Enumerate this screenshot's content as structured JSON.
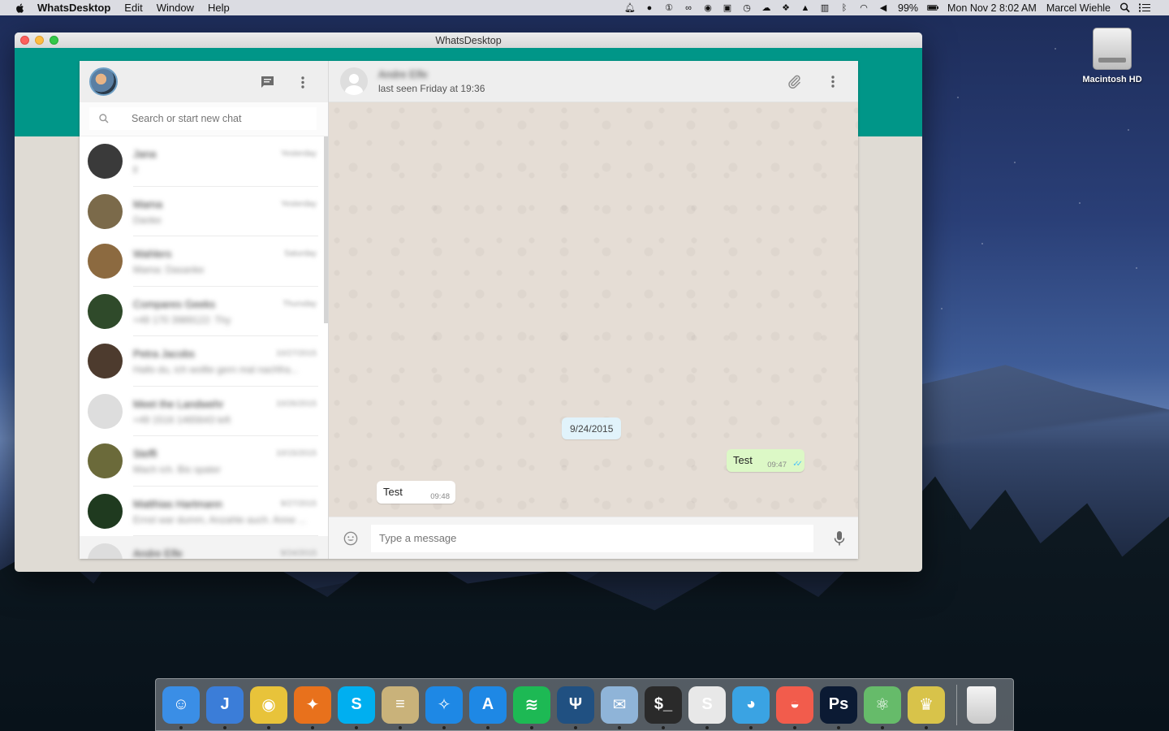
{
  "menubar": {
    "app_name": "WhatsDesktop",
    "menus": [
      "Edit",
      "Window",
      "Help"
    ],
    "battery": "99%",
    "datetime": "Mon Nov 2  8:02 AM",
    "user": "Marcel Wiehle"
  },
  "desktop": {
    "drive_label": "Macintosh HD"
  },
  "window": {
    "title": "WhatsDesktop"
  },
  "sidebar": {
    "search_placeholder": "Search or start new chat",
    "chats": [
      {
        "name": "Jana",
        "preview": "ll",
        "time": "Yesterday",
        "avatar_color": "#3a3a3a"
      },
      {
        "name": "Mama",
        "preview": "Danke",
        "time": "Yesterday",
        "avatar_color": "#7b6a4a"
      },
      {
        "name": "Wahlers",
        "preview": "Mama: Dasanke",
        "time": "Saturday",
        "avatar_color": "#8c6a40"
      },
      {
        "name": "Compares Geeks",
        "preview": "+49 170 3989122: Thy",
        "time": "Thursday",
        "avatar_color": "#2f4a2a"
      },
      {
        "name": "Petra Jacobs",
        "preview": "Hallo du, ich wollte gern mal nachfra...",
        "time": "10/27/2015",
        "avatar_color": "#4d3b2e"
      },
      {
        "name": "Meet the Landwehr",
        "preview": "+49 1516 1465643 left",
        "time": "10/26/2015",
        "avatar_color": "#dddddd"
      },
      {
        "name": "Steffi",
        "preview": "Mach ich. Bis spater",
        "time": "10/15/2015",
        "avatar_color": "#6b6a3a"
      },
      {
        "name": "Matthias Hartmann",
        "preview": "Ernst war dumm, Anzahle auch. Anne ...",
        "time": "9/27/2015",
        "avatar_color": "#1f3a1f"
      },
      {
        "name": "Andre Elfe",
        "preview": "",
        "time": "9/24/2015",
        "avatar_color": "#dddddd"
      }
    ]
  },
  "chat": {
    "contact_name": "Andre Elfe",
    "last_seen": "last seen Friday at 19:36",
    "date_divider": "9/24/2015",
    "messages": [
      {
        "direction": "out",
        "text": "Test",
        "time": "09:47"
      },
      {
        "direction": "in",
        "text": "Test",
        "time": "09:48"
      }
    ],
    "composer_placeholder": "Type a message"
  },
  "dock": {
    "apps": [
      {
        "name": "Finder",
        "color": "#3a8ee6",
        "glyph": "☺"
      },
      {
        "name": "Jira",
        "color": "#3b7dd8",
        "glyph": "J"
      },
      {
        "name": "Chrome",
        "color": "#e8c33a",
        "glyph": "◉"
      },
      {
        "name": "Firefox",
        "color": "#e8711c",
        "glyph": "✦"
      },
      {
        "name": "Skype",
        "color": "#00aff0",
        "glyph": "S"
      },
      {
        "name": "Sequel",
        "color": "#c9b27a",
        "glyph": "≡"
      },
      {
        "name": "Safari",
        "color": "#1e88e5",
        "glyph": "✧"
      },
      {
        "name": "App Store",
        "color": "#1e88e5",
        "glyph": "A"
      },
      {
        "name": "Spotify",
        "color": "#1db954",
        "glyph": "≋"
      },
      {
        "name": "SourceTree",
        "color": "#205081",
        "glyph": "Ψ"
      },
      {
        "name": "Preview",
        "color": "#8fb4d8",
        "glyph": "✉"
      },
      {
        "name": "Terminal",
        "color": "#2a2a2a",
        "glyph": "$_"
      },
      {
        "name": "Slack",
        "color": "#e8e8e8",
        "glyph": "S"
      },
      {
        "name": "Tweetbot",
        "color": "#3aa3e3",
        "glyph": "◕"
      },
      {
        "name": "Sunrise",
        "color": "#f25c4c",
        "glyph": "◒"
      },
      {
        "name": "Photoshop",
        "color": "#0b1a33",
        "glyph": "Ps"
      },
      {
        "name": "Atom",
        "color": "#66bb6a",
        "glyph": "⚛"
      },
      {
        "name": "Cyberduck",
        "color": "#d8c34a",
        "glyph": "♛"
      }
    ]
  }
}
